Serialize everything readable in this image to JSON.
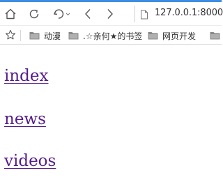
{
  "window": {
    "accent_color": "#3d8de2"
  },
  "toolbar": {
    "buttons": [
      {
        "name": "home-button",
        "icon": "home-icon"
      },
      {
        "name": "refresh-button",
        "icon": "refresh-icon"
      },
      {
        "name": "undo-button",
        "icon": "undo-icon"
      },
      {
        "name": "back-button",
        "icon": "chevron-left-icon"
      },
      {
        "name": "forward-button",
        "icon": "chevron-right-icon"
      }
    ],
    "address": {
      "url": "127.0.0.1:8000",
      "icon": "page-icon"
    }
  },
  "bookmarks": {
    "star_icon": "star-icon",
    "items": [
      {
        "label": "动漫",
        "icon": "folder-icon"
      },
      {
        "label": ".☆亲何★的书签",
        "icon": "folder-icon"
      },
      {
        "label": "网页开发",
        "icon": "folder-icon"
      },
      {
        "label": "",
        "icon": "folder-icon"
      }
    ]
  },
  "page": {
    "link_color": "#551a8b",
    "links": [
      {
        "label": "index"
      },
      {
        "label": "news"
      },
      {
        "label": "videos"
      }
    ]
  }
}
